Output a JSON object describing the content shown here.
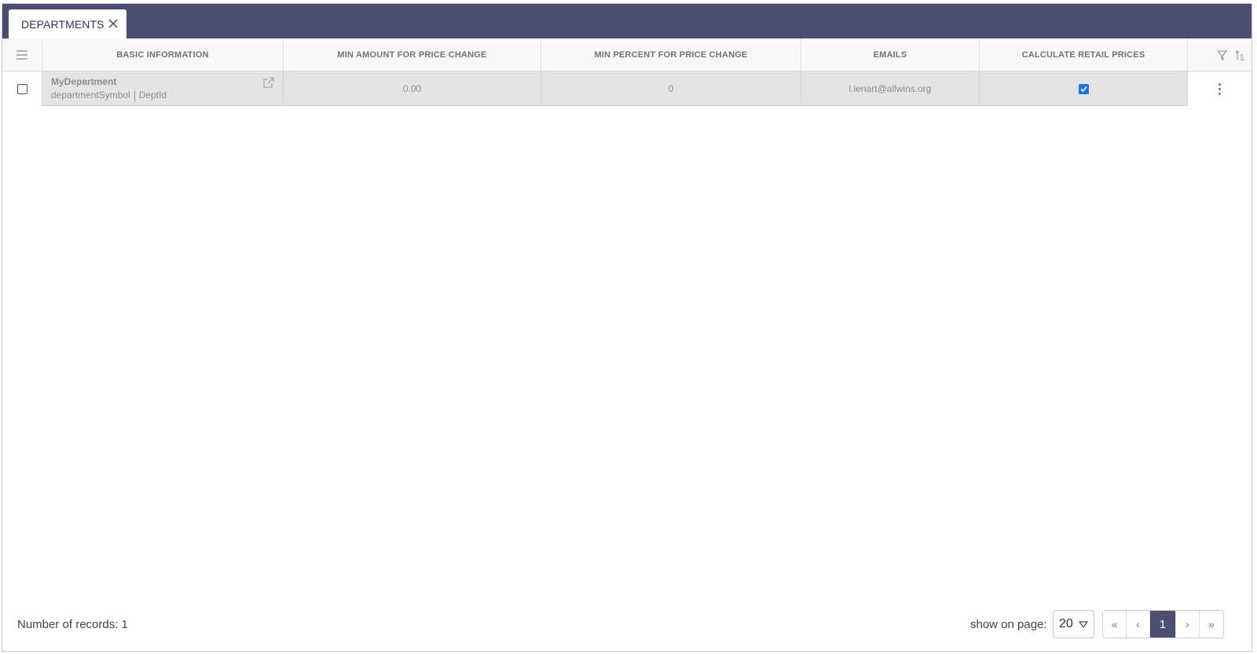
{
  "tab": {
    "label": "DEPARTMENTS"
  },
  "table": {
    "headers": {
      "basic_information": "BASIC INFORMATION",
      "min_amount": "MIN AMOUNT FOR PRICE CHANGE",
      "min_percent": "MIN PERCENT FOR PRICE CHANGE",
      "emails": "EMAILS",
      "calculate_retail_prices": "CALCULATE RETAIL PRICES"
    },
    "rows": [
      {
        "name": "MyDepartment",
        "symbol": "departmentSymbol",
        "dept_id": "DeptId",
        "min_amount": "0.00",
        "min_percent": "0",
        "email": "l.lenart@allwins.org",
        "calculate_retail_prices": true,
        "selected": false
      }
    ]
  },
  "footer": {
    "records_label": "Number of records: 1",
    "show_on_page_label": "show on page:",
    "page_size": "20",
    "first": "«",
    "prev": "‹",
    "current_page": "1",
    "next": "›",
    "last": "»"
  },
  "colors": {
    "header_bar": "#4b4e72",
    "checkbox_checked": "#1a73e8",
    "row_bg": "#e4e4e4"
  },
  "icons": [
    "close-icon",
    "menu-icon",
    "external-link-icon",
    "filter-icon",
    "sort-icon",
    "kebab-icon",
    "chevron-down-icon"
  ]
}
